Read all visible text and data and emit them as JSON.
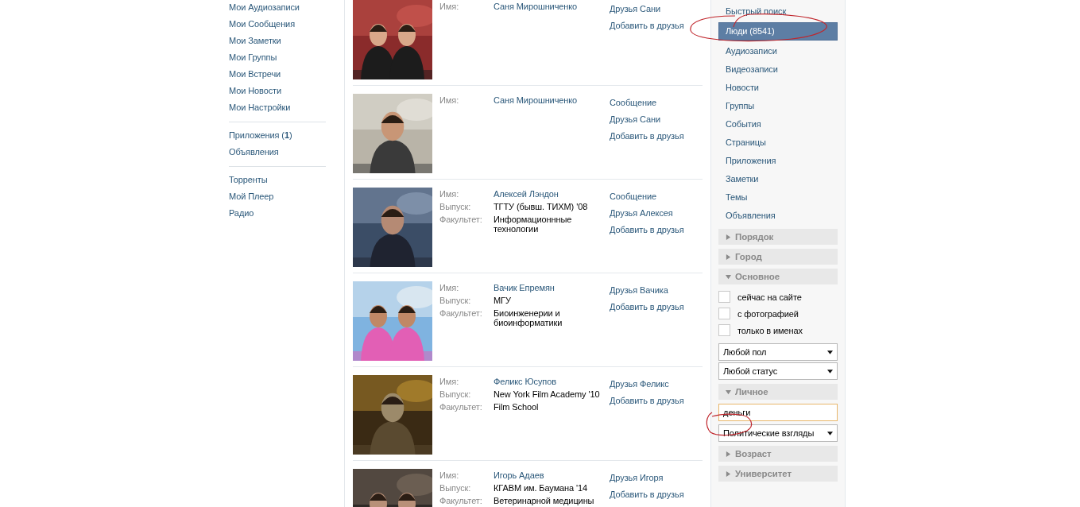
{
  "left_menu": [
    {
      "items": [
        "Мои Аудиозаписи",
        "Мои Сообщения",
        "Мои Заметки",
        "Мои Группы",
        "Мои Встречи",
        "Мои Новости",
        "Мои Настройки"
      ]
    },
    {
      "items": [
        "Приложения (**1**)",
        "Объявления"
      ]
    },
    {
      "items": [
        "Торренты",
        "Мой Плеер",
        "Радио"
      ]
    }
  ],
  "results": [
    {
      "photo": {
        "kind": "picture"
      },
      "fields": [
        {
          "label": "Имя:",
          "value": "Саня Мирошниченко",
          "kind": "name"
        }
      ],
      "actions": [
        "Друзья Сани",
        "Добавить в друзья"
      ]
    },
    {
      "photo": {
        "kind": "picture"
      },
      "fields": [
        {
          "label": "Имя:",
          "value": "Саня Мирошниченко",
          "kind": "name"
        }
      ],
      "actions": [
        "Сообщение",
        "Друзья Сани",
        "Добавить в друзья"
      ]
    },
    {
      "photo": {
        "kind": "picture"
      },
      "fields": [
        {
          "label": "Имя:",
          "value": "Алексей Лэндон",
          "kind": "name"
        },
        {
          "label": "Выпуск:",
          "value": "ТГТУ (бывш. ТИХМ) '08",
          "kind": "text"
        },
        {
          "label": "Факультет:",
          "value": "Информационнные технологии",
          "kind": "text"
        }
      ],
      "actions": [
        "Сообщение",
        "Друзья Алексея",
        "Добавить в друзья"
      ]
    },
    {
      "photo": {
        "kind": "picture"
      },
      "fields": [
        {
          "label": "Имя:",
          "value": "Вачик Епремян",
          "kind": "name"
        },
        {
          "label": "Выпуск:",
          "value": "МГУ",
          "kind": "text"
        },
        {
          "label": "Факультет:",
          "value": "Биоинженерии и биоинформатики",
          "kind": "text"
        }
      ],
      "actions": [
        "Друзья Вачика",
        "Добавить в друзья"
      ]
    },
    {
      "photo": {
        "kind": "picture"
      },
      "fields": [
        {
          "label": "Имя:",
          "value": "Феликс Юсупов",
          "kind": "name"
        },
        {
          "label": "Выпуск:",
          "value": "New York Film Academy '10",
          "kind": "text"
        },
        {
          "label": "Факультет:",
          "value": "Film School",
          "kind": "text"
        }
      ],
      "actions": [
        "Друзья Феликс",
        "Добавить в друзья"
      ]
    },
    {
      "photo": {
        "kind": "picture"
      },
      "fields": [
        {
          "label": "Имя:",
          "value": "Игорь Адаев",
          "kind": "name"
        },
        {
          "label": "Выпуск:",
          "value": "КГАВМ им. Баумана '14",
          "kind": "text"
        },
        {
          "label": "Факультет:",
          "value": "Ветеринарной медицины",
          "kind": "text"
        }
      ],
      "actions": [
        "Друзья Игоря",
        "Добавить в друзья"
      ]
    }
  ],
  "search_nav": [
    {
      "label": "Быстрый поиск",
      "selected": false
    },
    {
      "label": "Люди (8541)",
      "selected": true
    },
    {
      "label": "Аудиозаписи",
      "selected": false
    },
    {
      "label": "Видеозаписи",
      "selected": false
    },
    {
      "label": "Новости",
      "selected": false
    },
    {
      "label": "Группы",
      "selected": false
    },
    {
      "label": "События",
      "selected": false
    },
    {
      "label": "Страницы",
      "selected": false
    },
    {
      "label": "Приложения",
      "selected": false
    },
    {
      "label": "Заметки",
      "selected": false
    },
    {
      "label": "Темы",
      "selected": false
    },
    {
      "label": "Объявления",
      "selected": false
    }
  ],
  "filters": [
    {
      "kind": "header",
      "label": "Порядок",
      "expanded": false
    },
    {
      "kind": "header",
      "label": "Город",
      "expanded": false
    },
    {
      "kind": "header",
      "label": "Основное",
      "expanded": true
    },
    {
      "kind": "checkbox",
      "label": "сейчас на сайте",
      "checked": false
    },
    {
      "kind": "checkbox",
      "label": "с фотографией",
      "checked": false
    },
    {
      "kind": "checkbox",
      "label": "только в именах",
      "checked": false
    },
    {
      "kind": "select",
      "value": "Любой пол"
    },
    {
      "kind": "select",
      "value": "Любой статус"
    },
    {
      "kind": "header",
      "label": "Личное",
      "expanded": true
    },
    {
      "kind": "input",
      "value": "деньги"
    },
    {
      "kind": "select",
      "value": "Политические взгляды"
    },
    {
      "kind": "header",
      "label": "Возраст",
      "expanded": false
    },
    {
      "kind": "header",
      "label": "Университет",
      "expanded": false
    }
  ]
}
